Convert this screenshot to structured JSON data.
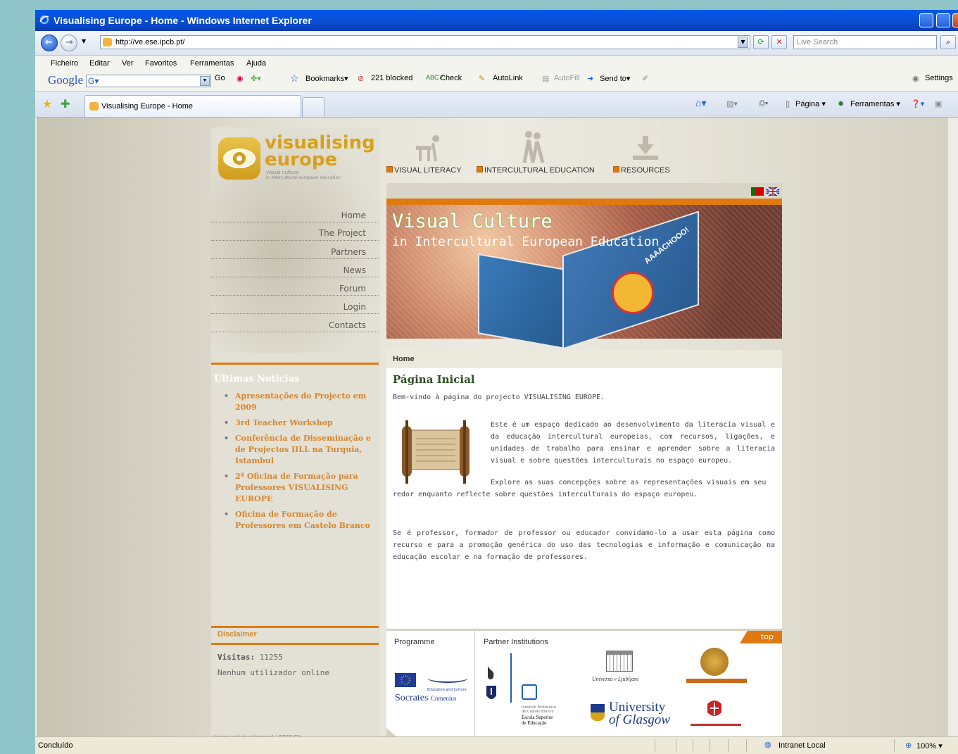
{
  "window": {
    "title": "Visualising Europe - Home - Windows Internet Explorer"
  },
  "address_bar": {
    "url": "http://ve.ese.ipcb.pt/",
    "search_placeholder": "Live Search"
  },
  "menu": [
    "Ficheiro",
    "Editar",
    "Ver",
    "Favoritos",
    "Ferramentas",
    "Ajuda"
  ],
  "google_toolbar": {
    "logo": "Google",
    "search_prefix": "G▾",
    "go": "Go",
    "bookmarks": "Bookmarks▾",
    "blocked": "221 blocked",
    "check": "Check",
    "autolink": "AutoLink",
    "autofill": "AutoFill",
    "send_to": "Send to▾",
    "settings": "Settings"
  },
  "tabs": {
    "active_label": "Visualising Europe - Home",
    "commands": {
      "page": "Página",
      "tools": "Ferramentas"
    }
  },
  "site": {
    "logo": {
      "line1": "visualising",
      "line2": "europe",
      "tag1": "visual culture",
      "tag2": "in intercultural european education"
    },
    "top_menu": [
      "VISUAL LITERACY",
      "INTERCULTURAL EDUCATION",
      "RESOURCES"
    ],
    "side_nav": [
      "Home",
      "The Project",
      "Partners",
      "News",
      "Forum",
      "Login",
      "Contacts"
    ],
    "banner": {
      "title1": "Visual Culture",
      "title2": "in Intercultural European Education",
      "book_word": "AAAACHOOO!"
    },
    "breadcrumb": "Home",
    "news": {
      "title": "Últimas Notícias",
      "items": [
        "Apresentações do Projecto em 2009",
        "3rd Teacher Workshop",
        "Conferência de Disseminação e de Projectos IILL na Turquia, Istambul",
        "2ª Oficina de Formação para Professores VISUALISING EUROPE",
        "Oficina de Formação de Professores em Castelo Branco"
      ]
    },
    "content": {
      "heading": "Página Inicial",
      "welcome": "Bem-vindo à página do projecto VISUALISING EUROPE.",
      "p1": "Este é um espaço dedicado ao desenvolvimento da literacia visual e da educação intercultural europeias, com recursos, ligações, e unidades de trabalho para ensinar e aprender sobre a literacia visual e sobre questões interculturais no espaço europeu.",
      "p2a": "Explore as suas concepções sobre as representações visuais em seu",
      "p2b": "redor enquanto reflecte sobre questões interculturais do espaço europeu.",
      "p3": "Se é professor, formador de professor ou educador convidamo-lo a usar esta página como recurso e para a promoção genérica do uso das tecnologias e informação e comunicação na educação escolar e na formação de professores."
    },
    "disclaimer": "Disclaimer",
    "visits_label": "Visitas:",
    "visits_value": "11255",
    "online": "Nenhum utilizador online",
    "credit": "design and development | GDESIGN",
    "footer": {
      "programme": "Programme",
      "partners": "Partner Institutions",
      "top": "top",
      "socrates": "Socrates",
      "comenius": "Comenius",
      "edu_culture": "Education and Culture",
      "ljubljani": "Univerza v Ljubljani",
      "glasgow1": "University",
      "glasgow2": "of Glasgow",
      "ipcb1": "Instituto Politécnico",
      "ipcb2": "de Castelo Branco",
      "ipcb3": "Escola Superior",
      "ipcb4": "de Educação"
    }
  },
  "status": {
    "text": "Concluído",
    "zone": "Intranet Local",
    "zoom": "100%"
  },
  "colors": {
    "accent": "#e07a10",
    "xp_blue": "#0a4fd4",
    "page_bg": "#8fc4c8"
  }
}
